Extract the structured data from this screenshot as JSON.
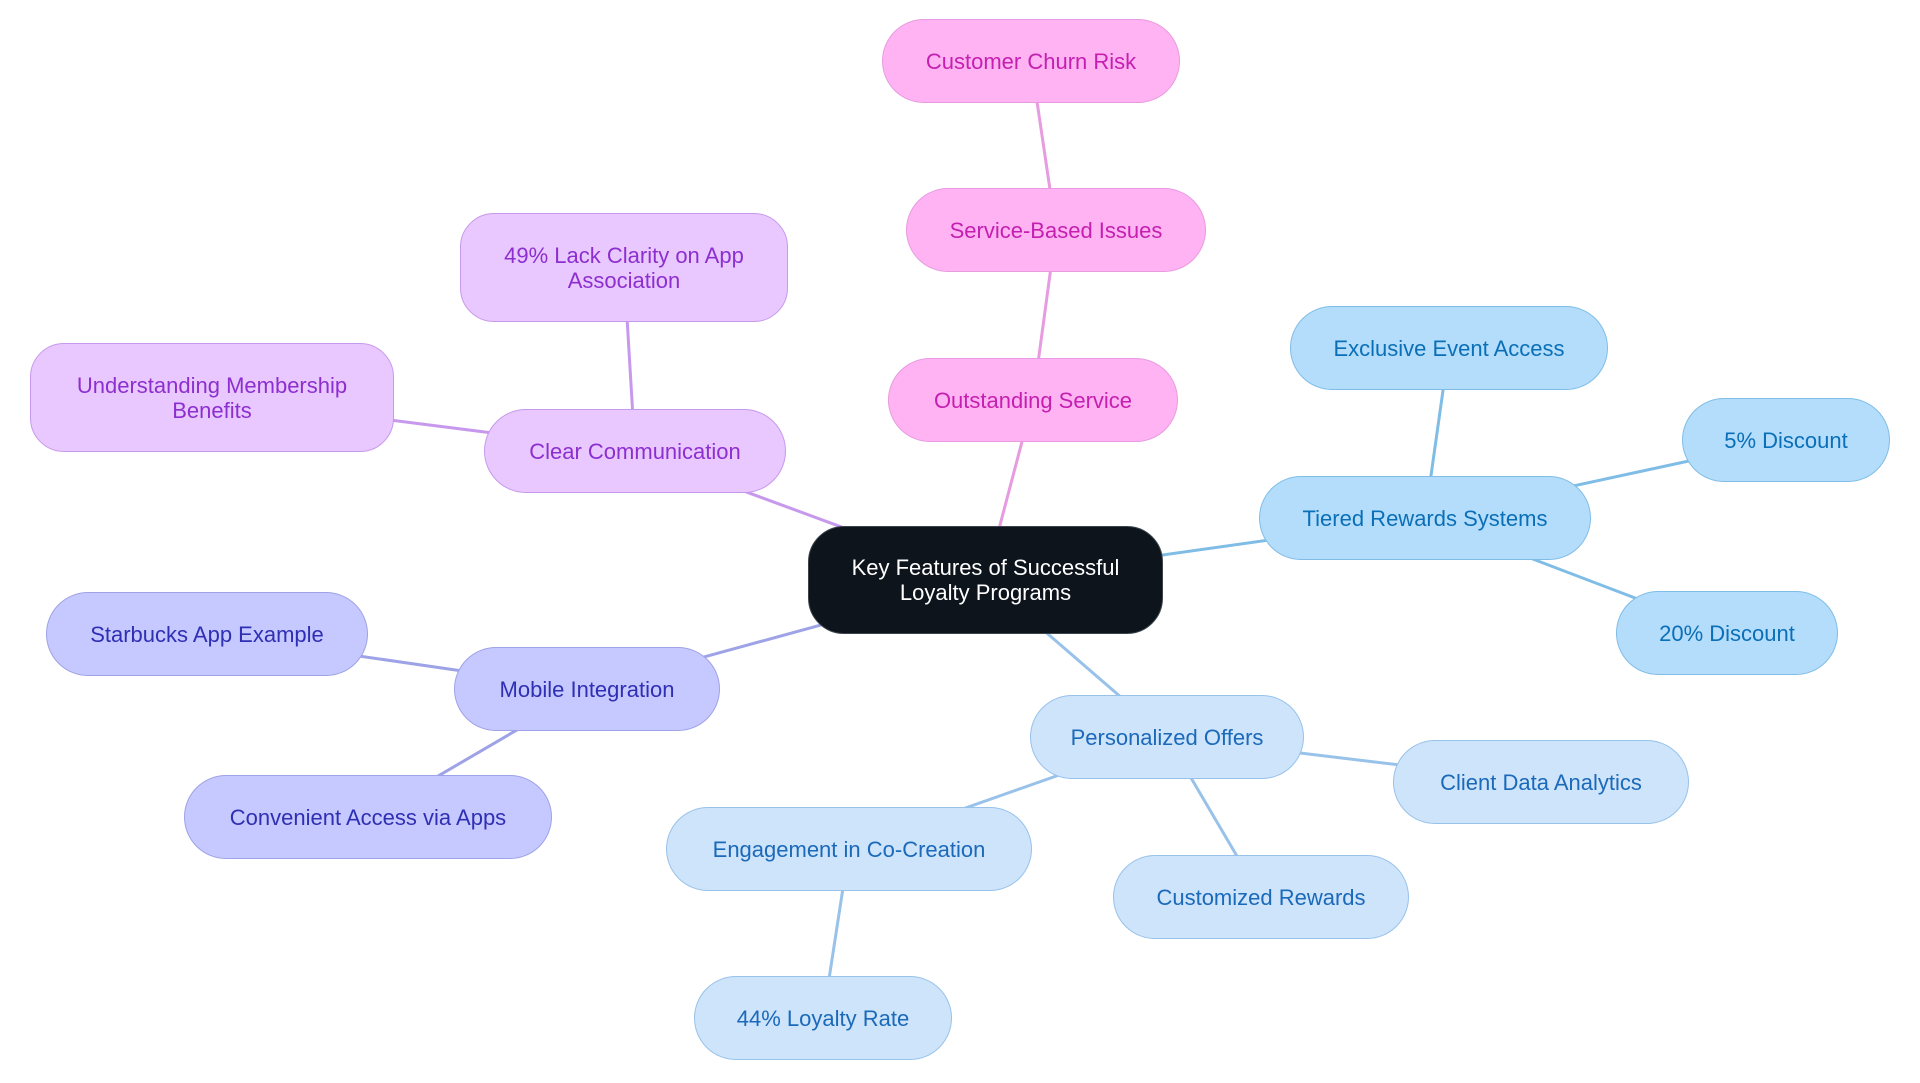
{
  "diagram": {
    "title": "Key Features of Successful Loyalty Programs",
    "root": {
      "id": "root",
      "label": "Key Features of Successful\nLoyalty Programs"
    },
    "branches": [
      {
        "id": "outstanding-service",
        "label": "Outstanding Service",
        "color": "#e79be0",
        "children": [
          {
            "id": "service-based-issues",
            "label": "Service-Based Issues",
            "children": [
              {
                "id": "customer-churn-risk",
                "label": "Customer Churn Risk"
              }
            ]
          }
        ]
      },
      {
        "id": "clear-communication",
        "label": "Clear Communication",
        "color": "#c799ec",
        "children": [
          {
            "id": "lack-clarity",
            "label": "49% Lack Clarity on App\nAssociation"
          },
          {
            "id": "understanding-benefits",
            "label": "Understanding Membership\nBenefits"
          }
        ]
      },
      {
        "id": "mobile-integration",
        "label": "Mobile Integration",
        "color": "#9ea2e6",
        "children": [
          {
            "id": "starbucks-app",
            "label": "Starbucks App Example"
          },
          {
            "id": "convenient-access",
            "label": "Convenient Access via Apps"
          }
        ]
      },
      {
        "id": "tiered-rewards",
        "label": "Tiered Rewards Systems",
        "color": "#80bde6",
        "children": [
          {
            "id": "exclusive-event",
            "label": "Exclusive Event Access"
          },
          {
            "id": "five-percent",
            "label": "5% Discount"
          },
          {
            "id": "twenty-percent",
            "label": "20% Discount"
          }
        ]
      },
      {
        "id": "personalized-offers",
        "label": "Personalized Offers",
        "color": "#98c2ea",
        "children": [
          {
            "id": "co-creation",
            "label": "Engagement in Co-Creation",
            "children": [
              {
                "id": "loyalty-rate",
                "label": "44% Loyalty Rate"
              }
            ]
          },
          {
            "id": "customized-rewards",
            "label": "Customized Rewards"
          },
          {
            "id": "client-data",
            "label": "Client Data Analytics"
          }
        ]
      }
    ]
  }
}
